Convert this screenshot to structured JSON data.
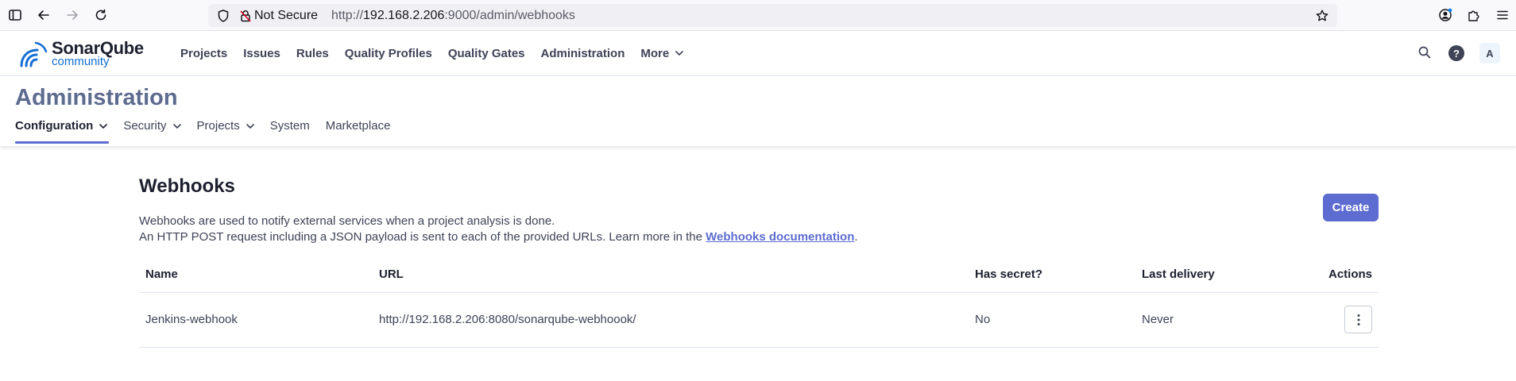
{
  "browser": {
    "not_secure": "Not Secure",
    "url_prefix": "http://",
    "url_host": "192.168.2.206",
    "url_rest": ":9000/admin/webhooks"
  },
  "header": {
    "logo_word": "SonarQube",
    "logo_sub": "community",
    "nav": [
      "Projects",
      "Issues",
      "Rules",
      "Quality Profiles",
      "Quality Gates",
      "Administration",
      "More"
    ],
    "avatar_initial": "A",
    "help_glyph": "?"
  },
  "admin": {
    "title": "Administration",
    "tabs": [
      "Configuration",
      "Security",
      "Projects",
      "System",
      "Marketplace"
    ]
  },
  "webhooks": {
    "title": "Webhooks",
    "desc_line1": "Webhooks are used to notify external services when a project analysis is done.",
    "desc_line2_pre": "An HTTP POST request including a JSON payload is sent to each of the provided URLs. Learn more in the ",
    "doc_link": "Webhooks documentation",
    "desc_line2_post": ".",
    "create_label": "Create",
    "columns": [
      "Name",
      "URL",
      "Has secret?",
      "Last delivery",
      "Actions"
    ],
    "rows": [
      {
        "name": "Jenkins-webhook",
        "url": "http://192.168.2.206:8080/sonarqube-webhoook/",
        "has_secret": "No",
        "last_delivery": "Never"
      }
    ]
  },
  "colors": {
    "accent": "#5d6cd0",
    "admin_title": "#5d6b8f",
    "logo_blue": "#126ed3"
  },
  "icons": {
    "sidebar": "sidebar-icon",
    "back": "back-arrow-icon",
    "forward": "forward-arrow-icon",
    "reload": "reload-icon",
    "shield": "shield-icon",
    "lock": "lock-slash-icon",
    "star": "star-icon",
    "account": "account-icon",
    "extensions": "puzzle-icon",
    "menu": "hamburger-icon",
    "search": "search-icon",
    "help": "help-icon",
    "kebab": "kebab-menu-icon"
  }
}
